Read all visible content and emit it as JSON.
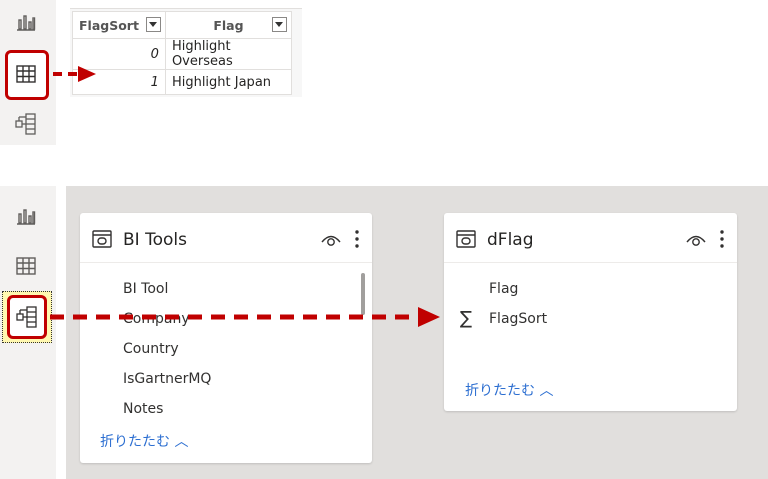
{
  "colors": {
    "accent_red": "#c00000",
    "link_blue": "#2d6fd1",
    "canvas_gray": "#e1dfdd"
  },
  "icons": [
    "report-view-icon",
    "data-view-icon",
    "model-view-icon",
    "table-icon",
    "eye-icon",
    "more-options-icon",
    "sigma-icon",
    "chevron-up-icon"
  ],
  "data_table": {
    "columns": [
      "FlagSort",
      "Flag"
    ],
    "rows": [
      {
        "flagsort": "0",
        "flag": "Highlight Overseas"
      },
      {
        "flagsort": "1",
        "flag": "Highlight Japan"
      }
    ]
  },
  "model": {
    "bi_tools": {
      "title": "BI Tools",
      "fields": [
        "BI Tool",
        "Company",
        "Country",
        "IsGartnerMQ",
        "Notes"
      ],
      "collapse_label": "折りたたむ ︿"
    },
    "dflag": {
      "title": "dFlag",
      "fields": [
        "Flag",
        "FlagSort"
      ],
      "collapse_label": "折りたたむ ︿"
    }
  }
}
